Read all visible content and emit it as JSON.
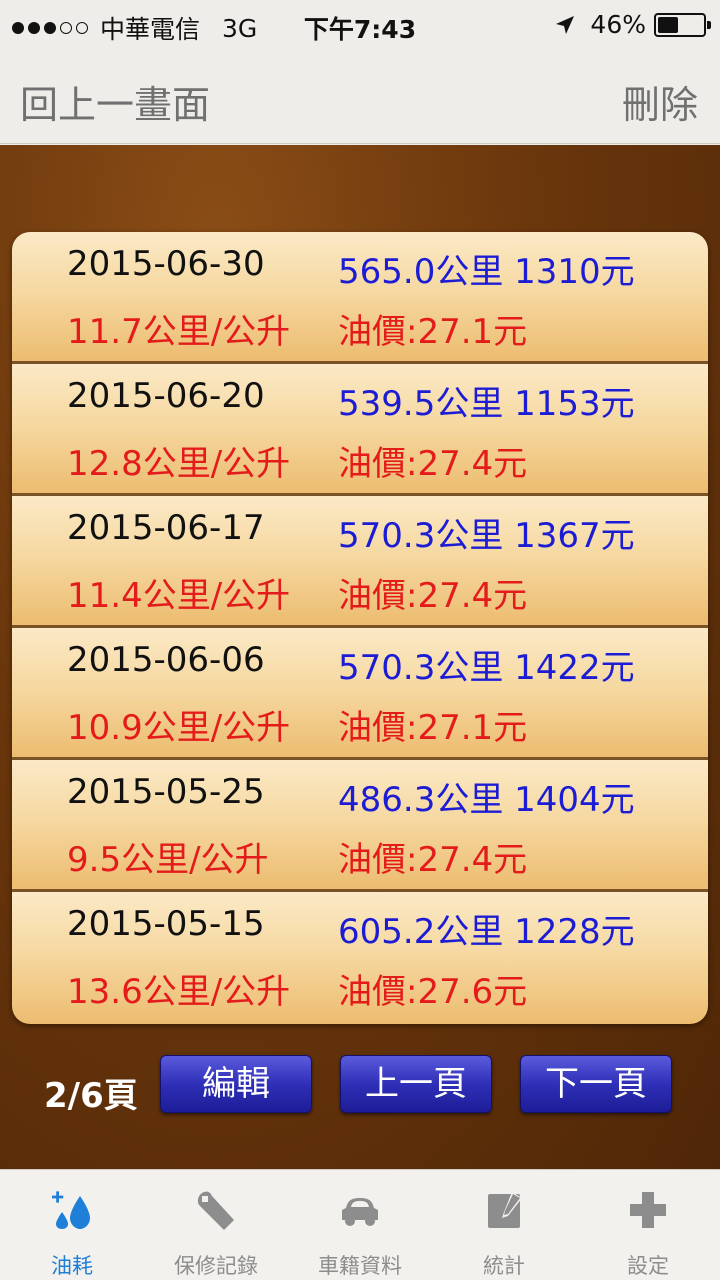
{
  "status": {
    "carrier": "中華電信",
    "network": "3G",
    "time": "下午7:43",
    "battery_text": "46%",
    "battery_level": 0.46,
    "location_icon": "location-arrow-icon"
  },
  "nav": {
    "back_label": "回上一畫面",
    "delete_label": "刪除"
  },
  "records": [
    {
      "date": "2015-06-30",
      "distance": "565.0公里 1310元",
      "economy": "11.7公里/公升",
      "price": "油價:27.1元"
    },
    {
      "date": "2015-06-20",
      "distance": "539.5公里 1153元",
      "economy": "12.8公里/公升",
      "price": "油價:27.4元"
    },
    {
      "date": "2015-06-17",
      "distance": "570.3公里 1367元",
      "economy": "11.4公里/公升",
      "price": "油價:27.4元"
    },
    {
      "date": "2015-06-06",
      "distance": "570.3公里 1422元",
      "economy": "10.9公里/公升",
      "price": "油價:27.1元"
    },
    {
      "date": "2015-05-25",
      "distance": "486.3公里 1404元",
      "economy": "9.5公里/公升",
      "price": "油價:27.4元"
    },
    {
      "date": "2015-05-15",
      "distance": "605.2公里 1228元",
      "economy": "13.6公里/公升",
      "price": "油價:27.6元"
    }
  ],
  "pager": {
    "page_text": "2/6頁",
    "edit_label": "編輯",
    "prev_label": "上一頁",
    "next_label": "下一頁"
  },
  "tabs": [
    {
      "label": "油耗",
      "icon": "fuel-drop-icon",
      "active": true
    },
    {
      "label": "保修記錄",
      "icon": "wrench-icon",
      "active": false
    },
    {
      "label": "車籍資料",
      "icon": "car-icon",
      "active": false
    },
    {
      "label": "統計",
      "icon": "notepad-icon",
      "active": false
    },
    {
      "label": "設定",
      "icon": "plus-icon",
      "active": false
    }
  ],
  "colors": {
    "active_tab": "#1f7fd8",
    "inactive_tab": "#8d8d8d",
    "distance_text": "#1c1cd4",
    "economy_text": "#e41b1b",
    "button_blue": "#2f2fb8"
  }
}
